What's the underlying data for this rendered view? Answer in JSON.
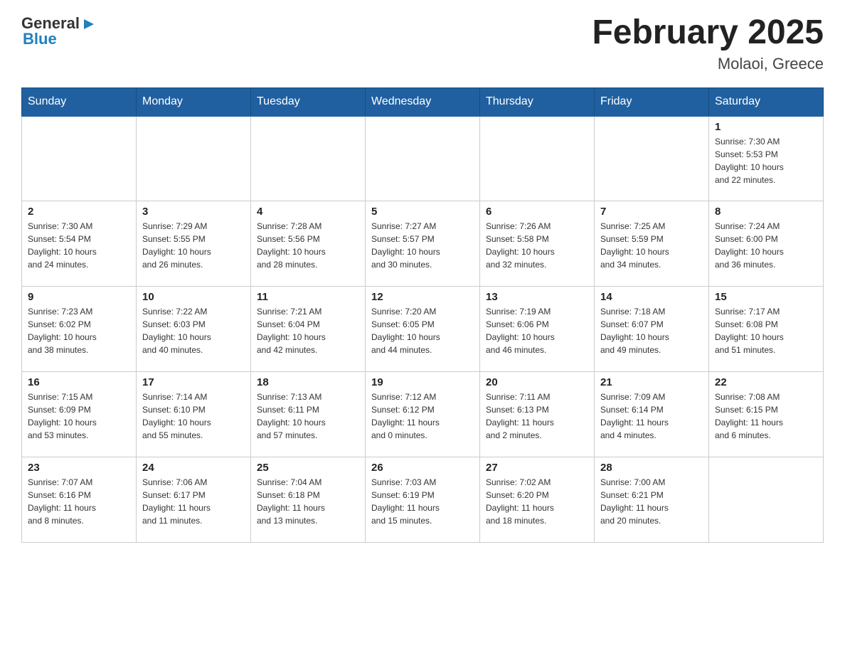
{
  "logo": {
    "text_general": "General",
    "text_blue": "Blue",
    "arrow": "▶"
  },
  "header": {
    "title": "February 2025",
    "subtitle": "Molaoi, Greece"
  },
  "days_of_week": [
    "Sunday",
    "Monday",
    "Tuesday",
    "Wednesday",
    "Thursday",
    "Friday",
    "Saturday"
  ],
  "weeks": [
    [
      {
        "day": "",
        "info": ""
      },
      {
        "day": "",
        "info": ""
      },
      {
        "day": "",
        "info": ""
      },
      {
        "day": "",
        "info": ""
      },
      {
        "day": "",
        "info": ""
      },
      {
        "day": "",
        "info": ""
      },
      {
        "day": "1",
        "info": "Sunrise: 7:30 AM\nSunset: 5:53 PM\nDaylight: 10 hours\nand 22 minutes."
      }
    ],
    [
      {
        "day": "2",
        "info": "Sunrise: 7:30 AM\nSunset: 5:54 PM\nDaylight: 10 hours\nand 24 minutes."
      },
      {
        "day": "3",
        "info": "Sunrise: 7:29 AM\nSunset: 5:55 PM\nDaylight: 10 hours\nand 26 minutes."
      },
      {
        "day": "4",
        "info": "Sunrise: 7:28 AM\nSunset: 5:56 PM\nDaylight: 10 hours\nand 28 minutes."
      },
      {
        "day": "5",
        "info": "Sunrise: 7:27 AM\nSunset: 5:57 PM\nDaylight: 10 hours\nand 30 minutes."
      },
      {
        "day": "6",
        "info": "Sunrise: 7:26 AM\nSunset: 5:58 PM\nDaylight: 10 hours\nand 32 minutes."
      },
      {
        "day": "7",
        "info": "Sunrise: 7:25 AM\nSunset: 5:59 PM\nDaylight: 10 hours\nand 34 minutes."
      },
      {
        "day": "8",
        "info": "Sunrise: 7:24 AM\nSunset: 6:00 PM\nDaylight: 10 hours\nand 36 minutes."
      }
    ],
    [
      {
        "day": "9",
        "info": "Sunrise: 7:23 AM\nSunset: 6:02 PM\nDaylight: 10 hours\nand 38 minutes."
      },
      {
        "day": "10",
        "info": "Sunrise: 7:22 AM\nSunset: 6:03 PM\nDaylight: 10 hours\nand 40 minutes."
      },
      {
        "day": "11",
        "info": "Sunrise: 7:21 AM\nSunset: 6:04 PM\nDaylight: 10 hours\nand 42 minutes."
      },
      {
        "day": "12",
        "info": "Sunrise: 7:20 AM\nSunset: 6:05 PM\nDaylight: 10 hours\nand 44 minutes."
      },
      {
        "day": "13",
        "info": "Sunrise: 7:19 AM\nSunset: 6:06 PM\nDaylight: 10 hours\nand 46 minutes."
      },
      {
        "day": "14",
        "info": "Sunrise: 7:18 AM\nSunset: 6:07 PM\nDaylight: 10 hours\nand 49 minutes."
      },
      {
        "day": "15",
        "info": "Sunrise: 7:17 AM\nSunset: 6:08 PM\nDaylight: 10 hours\nand 51 minutes."
      }
    ],
    [
      {
        "day": "16",
        "info": "Sunrise: 7:15 AM\nSunset: 6:09 PM\nDaylight: 10 hours\nand 53 minutes."
      },
      {
        "day": "17",
        "info": "Sunrise: 7:14 AM\nSunset: 6:10 PM\nDaylight: 10 hours\nand 55 minutes."
      },
      {
        "day": "18",
        "info": "Sunrise: 7:13 AM\nSunset: 6:11 PM\nDaylight: 10 hours\nand 57 minutes."
      },
      {
        "day": "19",
        "info": "Sunrise: 7:12 AM\nSunset: 6:12 PM\nDaylight: 11 hours\nand 0 minutes."
      },
      {
        "day": "20",
        "info": "Sunrise: 7:11 AM\nSunset: 6:13 PM\nDaylight: 11 hours\nand 2 minutes."
      },
      {
        "day": "21",
        "info": "Sunrise: 7:09 AM\nSunset: 6:14 PM\nDaylight: 11 hours\nand 4 minutes."
      },
      {
        "day": "22",
        "info": "Sunrise: 7:08 AM\nSunset: 6:15 PM\nDaylight: 11 hours\nand 6 minutes."
      }
    ],
    [
      {
        "day": "23",
        "info": "Sunrise: 7:07 AM\nSunset: 6:16 PM\nDaylight: 11 hours\nand 8 minutes."
      },
      {
        "day": "24",
        "info": "Sunrise: 7:06 AM\nSunset: 6:17 PM\nDaylight: 11 hours\nand 11 minutes."
      },
      {
        "day": "25",
        "info": "Sunrise: 7:04 AM\nSunset: 6:18 PM\nDaylight: 11 hours\nand 13 minutes."
      },
      {
        "day": "26",
        "info": "Sunrise: 7:03 AM\nSunset: 6:19 PM\nDaylight: 11 hours\nand 15 minutes."
      },
      {
        "day": "27",
        "info": "Sunrise: 7:02 AM\nSunset: 6:20 PM\nDaylight: 11 hours\nand 18 minutes."
      },
      {
        "day": "28",
        "info": "Sunrise: 7:00 AM\nSunset: 6:21 PM\nDaylight: 11 hours\nand 20 minutes."
      },
      {
        "day": "",
        "info": ""
      }
    ]
  ],
  "colors": {
    "header_bg": "#1f5f9f",
    "header_text": "#ffffff",
    "border": "#cccccc",
    "row_border_top": "#1f5f9f",
    "empty_bg": "#f8f8f8"
  }
}
